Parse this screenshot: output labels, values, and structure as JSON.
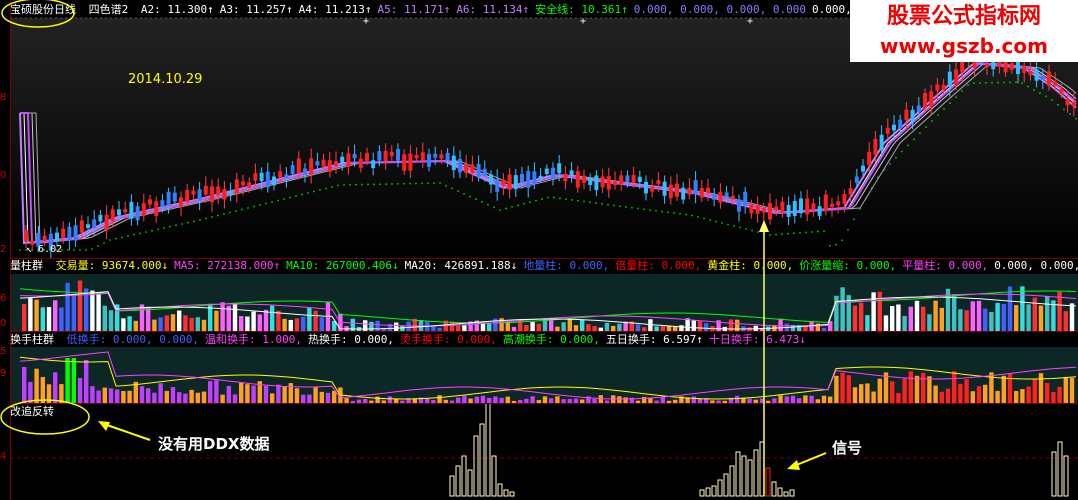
{
  "main": {
    "stock": "宝硕股份",
    "period": "日线",
    "indicator": "四色谱2",
    "items": [
      {
        "t": "A2: 11.300↑",
        "c": "#ffffff"
      },
      {
        "t": "A3: 11.257↑",
        "c": "#ffffff"
      },
      {
        "t": "A4: 11.213↑",
        "c": "#ffffff"
      },
      {
        "t": "A5: 11.171↑",
        "c": "#c080ff"
      },
      {
        "t": "A6: 11.134↑",
        "c": "#c080ff"
      },
      {
        "t": "安全线: 10.361↑",
        "c": "#00ff00"
      },
      {
        "t": "0.000, 0.000, 0.000, 0.000",
        "c": "#8080ff"
      },
      {
        "t": "0.000, 0",
        "c": "#ffffff"
      }
    ],
    "date": "2014.10.29",
    "low": "6.02",
    "axis": [
      "8",
      "0",
      "2"
    ]
  },
  "vol": {
    "title": "量柱群",
    "items": [
      {
        "t": "交易量: 93674.000↓",
        "c": "#ffff00"
      },
      {
        "t": "MA5: 272138.000↑",
        "c": "#ff40ff"
      },
      {
        "t": "MA10: 267000.406↓",
        "c": "#00ff00"
      },
      {
        "t": "MA20: 426891.188↓",
        "c": "#ffffff"
      },
      {
        "t": "地量柱: 0.000,",
        "c": "#4060ff"
      },
      {
        "t": "倍量柱: 0.000,",
        "c": "#ff0000"
      },
      {
        "t": "黄金柱: 0.000,",
        "c": "#ffff00"
      },
      {
        "t": "价涨量缩: 0.000,",
        "c": "#00ff00"
      },
      {
        "t": "平量柱: 0.000,",
        "c": "#ff40ff"
      },
      {
        "t": "0.000, 0.000, 0",
        "c": "#ffffff"
      }
    ],
    "axis": [
      "6",
      "0"
    ]
  },
  "turn": {
    "title": "换手柱群",
    "items": [
      {
        "t": "低换手: 0.000, 0.000,",
        "c": "#4060ff"
      },
      {
        "t": "温和换手: 1.000,",
        "c": "#ff40ff"
      },
      {
        "t": "热换手: 0.000,",
        "c": "#ffffff"
      },
      {
        "t": "烫手换手: 0.000,",
        "c": "#ff0000"
      },
      {
        "t": "高潮换手: 0.000,",
        "c": "#00ff00"
      },
      {
        "t": "五日换手: 6.597↑",
        "c": "#ffffff"
      },
      {
        "t": "十日换手: 6.473↓",
        "c": "#ff40ff"
      }
    ],
    "axis": [
      "5",
      "9"
    ]
  },
  "ddx": {
    "title": "改追反转",
    "axis": [
      "4"
    ]
  },
  "annotations": {
    "no_ddx": "没有用DDX数据",
    "signal": "信号"
  },
  "watermark": {
    "line1": "股票公式指标网",
    "line2": "www.gszb.com"
  }
}
